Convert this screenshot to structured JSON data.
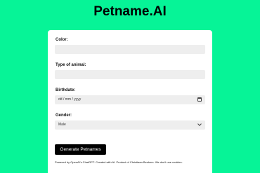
{
  "header": {
    "title": "Petname.AI"
  },
  "form": {
    "color": {
      "label": "Color:",
      "value": ""
    },
    "animal": {
      "label": "Type of animal:",
      "value": ""
    },
    "birthdate": {
      "label": "Birthdate:",
      "placeholder": "dd / mm / yyyy"
    },
    "gender": {
      "label": "Gender:",
      "selected": "Male"
    },
    "submit_label": "Generate Petnames"
  },
  "footer": {
    "text": "Powered by OpenAI's ChatGPT. Created with AI. Product of Christiaan Beukers. We don't use cookies."
  },
  "colors": {
    "background": "#06f497",
    "card": "#ffffff",
    "field": "#eeeeee",
    "button": "#000000"
  }
}
